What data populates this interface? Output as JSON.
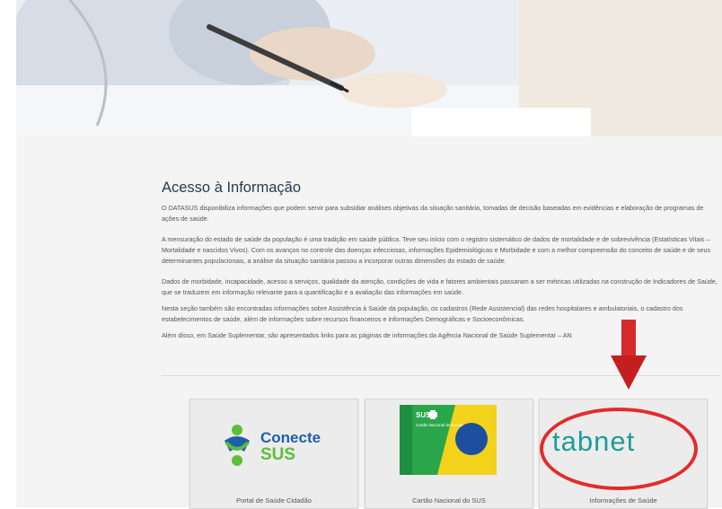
{
  "page": {
    "title": "Acesso à Informação",
    "paragraphs": [
      "O DATASUS disponibiliza informações que podem servir para subsidiar  análises objetivas da situação sanitária, tomadas de decisão baseadas em evidências e elaboração de programas de ações de saúde.",
      "A mensuração do estado de saúde da população é uma tradição em saúde pública. Teve seu início com o registro sistemático de dados de mortalidade e de sobrevivência (Estatísticas Vitais – Mortalidade e nascidos Vivos). Com os avanços no controle das doenças infecciosas, informações Epidemiológicas e Morbidade e com a melhor compreensão do conceito de saúde e de seus determinantes populacionais, a análise da situação sanitária passou a incorporar outras dimensões do estado de saúde.",
      "Dados de morbidade, incapacidade, acesso a serviços, qualidade da atenção, condições de vida e fatores ambientais passaram a ser métricas utilizadas na construção de Indicadores de Saúde, que se traduzem em informação relevante para a quantificação e a avaliação das informações em saúde.",
      "Nesta seção também são encontradas informações sobre Assistência à Saúde da população, os cadastros (Rede Assistencial) das redes hospitalares e ambulatoriais, o cadastro dos estabelecimentos de saúde, além de informações sobre  recursos financeiros e informações Demográficas e Socioeconômicas.",
      "Além disso, em Saúde Suplementar, são apresentados links para as páginas de informações da Agência Nacional de Saúde Suplementar – AN"
    ]
  },
  "cards": [
    {
      "label": "Portal de Saúde Cidadão",
      "logo_line1": "Conecte",
      "logo_line2": "SUS"
    },
    {
      "label": "Cartão Nacional do SUS",
      "logo_sus": "SUS",
      "logo_caption": "Cartão Nacional de Saúde"
    },
    {
      "label": "Informações de Saúde",
      "logo_text": "tabnet"
    }
  ],
  "colors": {
    "conecte_blue": "#1f5fa8",
    "conecte_green": "#5bbf3a",
    "tabnet_teal": "#1d9c9a",
    "highlight_red": "#e32b2b",
    "card_green": "#2aa64a"
  },
  "icons": [
    "down-arrow-icon",
    "highlight-ellipse"
  ]
}
